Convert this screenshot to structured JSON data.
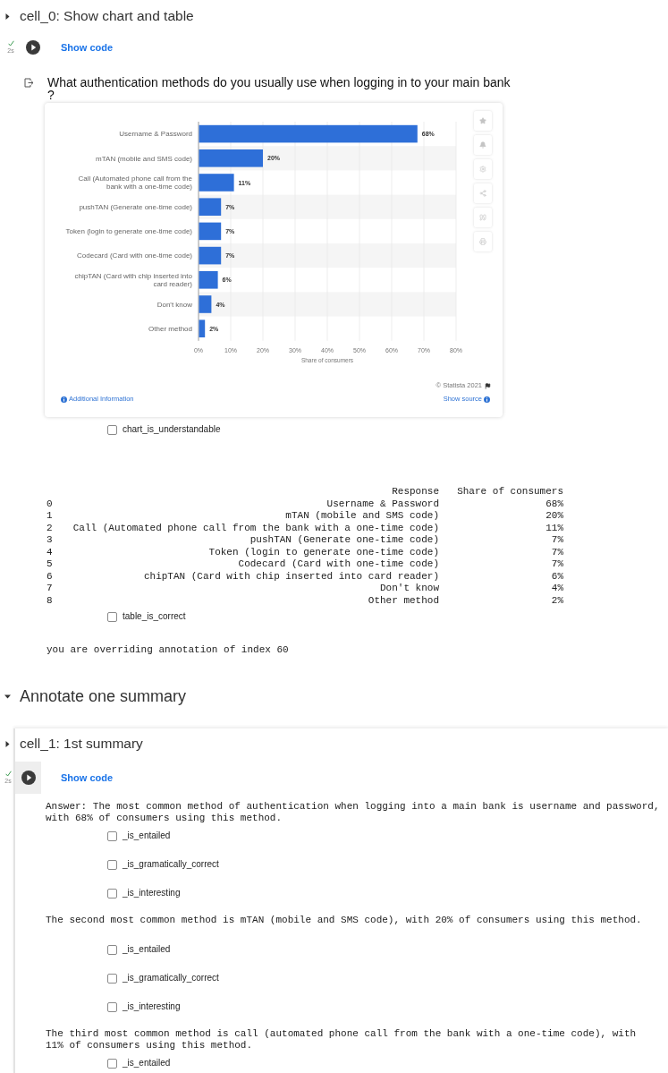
{
  "cell_0": {
    "title": "cell_0: Show chart and table",
    "expanded": false,
    "status": {
      "done": true,
      "time": "2s"
    },
    "run_highlighted": false,
    "show_code": "Show code",
    "output": {
      "question": "What authentication methods do you usually use when logging in to your main bank ?",
      "chart": {
        "chart_data": {
          "type": "bar",
          "orientation": "horizontal",
          "grid": true,
          "categories": [
            "Username & Password",
            "mTAN (mobile and SMS code)",
            "Call (Automated phone call from the bank with a one-time code)",
            "pushTAN (Generate one-time code)",
            "Token (login to generate one-time code)",
            "Codecard (Card with one-time code)",
            "chipTAN (Card with chip inserted into card reader)",
            "Don't know",
            "Other method"
          ],
          "values": [
            68,
            20,
            11,
            7,
            7,
            7,
            6,
            4,
            2
          ],
          "xlabel": "Share of consumers",
          "xlim": [
            0,
            80
          ],
          "xticks": [
            {
              "value": 0,
              "label": "0%"
            },
            {
              "value": 10,
              "label": "10%"
            },
            {
              "value": 20,
              "label": "20%"
            },
            {
              "value": 30,
              "label": "30%"
            },
            {
              "value": 40,
              "label": "40%"
            },
            {
              "value": 50,
              "label": "50%"
            },
            {
              "value": 60,
              "label": "60%"
            },
            {
              "value": 70,
              "label": "70%"
            },
            {
              "value": 80,
              "label": "80%"
            }
          ],
          "value_labels": [
            "68%",
            "20%",
            "11%",
            "7%",
            "7%",
            "7%",
            "6%",
            "4%",
            "2%"
          ]
        },
        "credit": "© Statista 2021",
        "info_link": "Additional Information",
        "source_link": "Show source"
      },
      "chart_check": {
        "label": "chart_is_understandable",
        "checked": false
      },
      "table": {
        "columns": [
          "Response",
          "Share of consumers"
        ],
        "rows": [
          {
            "index": "0",
            "response": "Username & Password",
            "share": "68%"
          },
          {
            "index": "1",
            "response": "mTAN (mobile and SMS code)",
            "share": "20%"
          },
          {
            "index": "2",
            "response": "Call (Automated phone call from the bank with a one-time code)",
            "share": "11%"
          },
          {
            "index": "3",
            "response": "pushTAN (Generate one-time code)",
            "share": "7%"
          },
          {
            "index": "4",
            "response": "Token (login to generate one-time code)",
            "share": "7%"
          },
          {
            "index": "5",
            "response": "Codecard (Card with one-time code)",
            "share": "7%"
          },
          {
            "index": "6",
            "response": "chipTAN (Card with chip inserted into card reader)",
            "share": "6%"
          },
          {
            "index": "7",
            "response": "Don't know",
            "share": "4%"
          },
          {
            "index": "8",
            "response": "Other method",
            "share": "2%"
          }
        ]
      },
      "table_check": {
        "label": "table_is_correct",
        "checked": false
      },
      "message": "you are overriding annotation of index 60"
    }
  },
  "section": {
    "title": "Annotate one summary",
    "expanded": true
  },
  "cell_1": {
    "title": "cell_1: 1st summary",
    "expanded": false,
    "status": {
      "done": true,
      "time": "2s"
    },
    "run_highlighted": true,
    "show_code": "Show code",
    "sentences": [
      {
        "text": "Answer: The most common method of authentication when logging into a main bank is username and password,\nwith 68% of consumers using this method.",
        "checks": [
          {
            "label": "_is_entailed",
            "checked": false
          },
          {
            "label": "_is_gramatically_correct",
            "checked": false
          },
          {
            "label": "_is_interesting",
            "checked": false
          }
        ]
      },
      {
        "text": "The second most common method is mTAN (mobile and SMS code), with 20% of consumers using this method.",
        "checks": [
          {
            "label": "_is_entailed",
            "checked": false
          },
          {
            "label": "_is_gramatically_correct",
            "checked": false
          },
          {
            "label": "_is_interesting",
            "checked": false
          }
        ]
      },
      {
        "text": "The third most common method is call (automated phone call from the bank with a one-time code), with\n11% of consumers using this method.",
        "checks": [
          {
            "label": "_is_entailed",
            "checked": false
          }
        ]
      }
    ]
  }
}
